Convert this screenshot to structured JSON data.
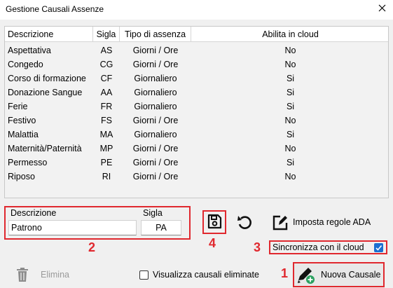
{
  "window": {
    "title": "Gestione Causali Assenze"
  },
  "table": {
    "headers": [
      "Descrizione",
      "Sigla",
      "Tipo di assenza",
      "Abilita in cloud"
    ],
    "rows": [
      [
        "Aspettativa",
        "AS",
        "Giorni / Ore",
        "No"
      ],
      [
        "Congedo",
        "CG",
        "Giorni / Ore",
        "No"
      ],
      [
        "Corso di formazione",
        "CF",
        "Giornaliero",
        "Si"
      ],
      [
        "Donazione Sangue",
        "AA",
        "Giornaliero",
        "Si"
      ],
      [
        "Ferie",
        "FR",
        "Giornaliero",
        "Si"
      ],
      [
        "Festivo",
        "FS",
        "Giorni / Ore",
        "No"
      ],
      [
        "Malattia",
        "MA",
        "Giornaliero",
        "Si"
      ],
      [
        "Maternità/Paternità",
        "MP",
        "Giorni / Ore",
        "No"
      ],
      [
        "Permesso",
        "PE",
        "Giorni / Ore",
        "Si"
      ],
      [
        "Riposo",
        "RI",
        "Giorni / Ore",
        "No"
      ]
    ]
  },
  "edit": {
    "descrizione_label": "Descrizione",
    "sigla_label": "Sigla",
    "descrizione_value": "Patrono",
    "sigla_value": "PA"
  },
  "toolbar": {
    "imposta_label": "Imposta regole ADA",
    "sync_label": "Sincronizza con il cloud",
    "sync_checked": true,
    "elimina_label": "Elimina",
    "visualizza_label": "Visualizza causali eliminate",
    "visualizza_checked": false,
    "nuova_label": "Nuova Causale"
  },
  "annotations": {
    "n1": "1",
    "n2": "2",
    "n3": "3",
    "n4": "4"
  },
  "colors": {
    "annotation": "#e0282e",
    "checkbox_checked": "#1a6fd1"
  },
  "icons": {
    "close": "close-icon",
    "save": "floppy-disk-icon",
    "undo": "undo-icon",
    "edit": "pencil-square-icon",
    "trash": "trash-icon",
    "new": "pencil-plus-icon"
  }
}
